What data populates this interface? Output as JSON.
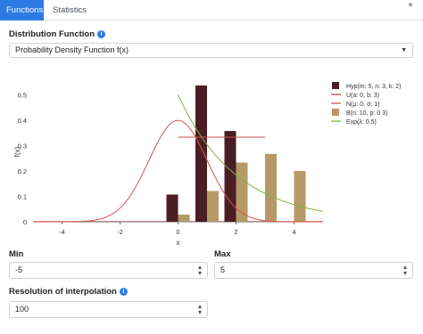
{
  "tabs": [
    {
      "label": "Functions",
      "active": true
    },
    {
      "label": "Statistics",
      "active": false
    }
  ],
  "menu_icon": "dot",
  "distribution": {
    "label": "Distribution Function",
    "selected": "Probability Density Function f(x)"
  },
  "inputs": {
    "min_label": "Min",
    "min_value": "-5",
    "max_label": "Max",
    "max_value": "5",
    "resolution_label": "Resolution of interpolation",
    "resolution_value": "100"
  },
  "colors": {
    "accent": "#2c7be5",
    "hyp": "#4a1e24",
    "binom": "#b59a66",
    "uniform": "#c44e52",
    "normal": "#d9534f",
    "exp": "#7cb342"
  },
  "chart_data": {
    "type": "bar",
    "xlabel": "x",
    "ylabel": "f(x)",
    "xlim": [
      -5,
      5
    ],
    "ylim": [
      0,
      0.55
    ],
    "x_ticks": [
      -4,
      -2,
      0,
      2,
      4
    ],
    "y_ticks": [
      0,
      0.1,
      0.2,
      0.3,
      0.4,
      0.5
    ],
    "legend_position": "right",
    "bar_series": [
      {
        "name": "Hyp(m: 5, n: 3, k: 2)",
        "color": "#4a1e24",
        "x": [
          0,
          1,
          2
        ],
        "values": [
          0.107,
          0.536,
          0.357
        ]
      },
      {
        "name": "B(n: 10, p: 0.3)",
        "color": "#b59a66",
        "x": [
          0,
          1,
          2,
          3,
          4
        ],
        "values": [
          0.028,
          0.121,
          0.233,
          0.267,
          0.2
        ]
      }
    ],
    "line_series": [
      {
        "name": "U(a: 0, b: 3)",
        "color": "#c44e52",
        "x": [
          0,
          3
        ],
        "values": [
          0.333,
          0.333
        ]
      },
      {
        "name": "N(μ: 0, σ: 1)",
        "color": "#d9534f",
        "function": "normal",
        "mu": 0,
        "sigma": 1
      },
      {
        "name": "Exp(λ: 0.5)",
        "color": "#7cb342",
        "function": "exp",
        "lambda": 0.5
      }
    ]
  }
}
